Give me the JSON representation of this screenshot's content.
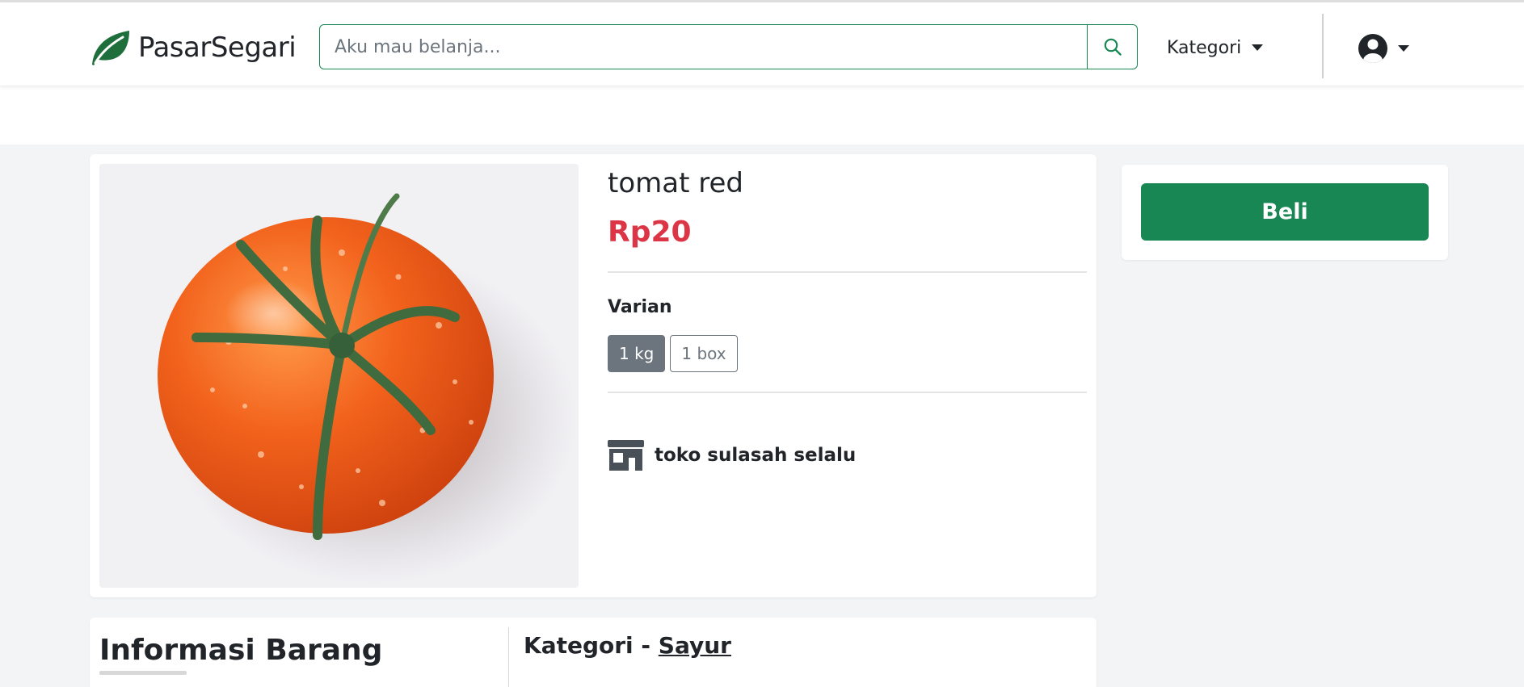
{
  "header": {
    "brand_name": "PasarSegari",
    "brand_color": "#1e6f3c",
    "search_placeholder": "Aku mau belanja...",
    "kategori_label": "Kategori",
    "icons": {
      "logo": "leaf-icon",
      "search": "search-icon",
      "account": "user-circle-icon"
    }
  },
  "product": {
    "name": "tomat red",
    "price": "Rp20",
    "price_color": "#dc3545",
    "variant_label": "Varian",
    "variants": [
      {
        "label": "1 kg",
        "selected": true
      },
      {
        "label": "1 box",
        "selected": false
      }
    ],
    "store_name": "toko sulasah selalu",
    "store_icon": "store-icon",
    "image": "tomato-photo"
  },
  "buy": {
    "label": "Beli",
    "color": "#198754"
  },
  "details": {
    "section_title": "Informasi Barang",
    "category_prefix": "Kategori - ",
    "category_value": "Sayur"
  }
}
